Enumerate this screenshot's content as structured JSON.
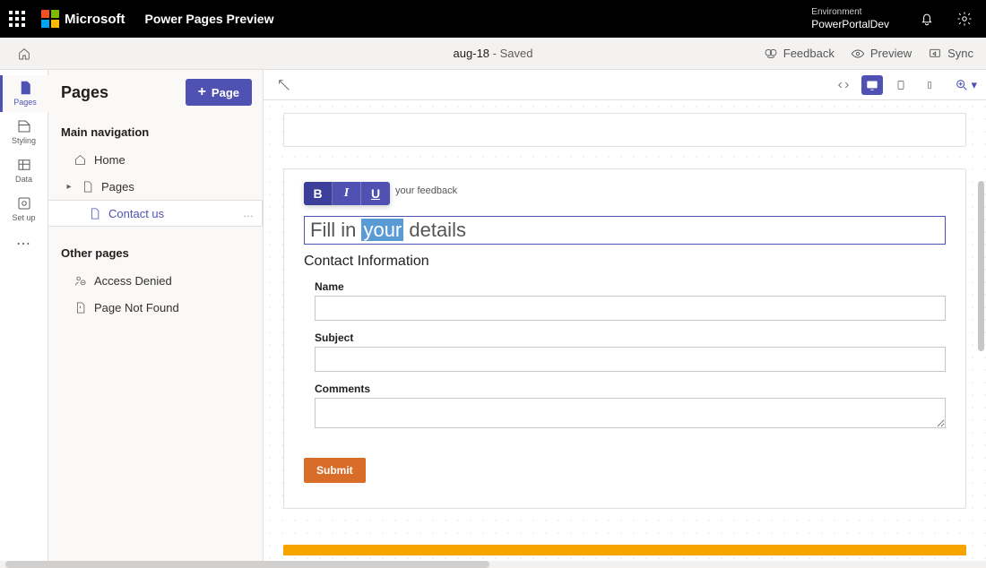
{
  "titlebar": {
    "brand": "Microsoft",
    "product": "Power Pages Preview",
    "environment_label": "Environment",
    "environment_name": "PowerPortalDev"
  },
  "cmdbar": {
    "site_name": "aug-18",
    "status": " - Saved",
    "feedback": "Feedback",
    "preview": "Preview",
    "sync": "Sync"
  },
  "rail": {
    "pages": "Pages",
    "styling": "Styling",
    "data": "Data",
    "setup": "Set up"
  },
  "panel": {
    "title": "Pages",
    "new_page": "Page",
    "section_main": "Main navigation",
    "section_other": "Other pages",
    "items": {
      "home": "Home",
      "pages": "Pages",
      "contact": "Contact us",
      "access_denied": "Access Denied",
      "not_found": "Page Not Found"
    }
  },
  "editor": {
    "feedback_trail": "your feedback",
    "heading_pre": "Fill in ",
    "heading_sel": "your",
    "heading_post": " details",
    "subheading": "Contact Information",
    "fields": {
      "name": "Name",
      "subject": "Subject",
      "comments": "Comments"
    },
    "submit": "Submit",
    "mini": {
      "bold": "B",
      "italic": "I",
      "underline": "U"
    }
  }
}
